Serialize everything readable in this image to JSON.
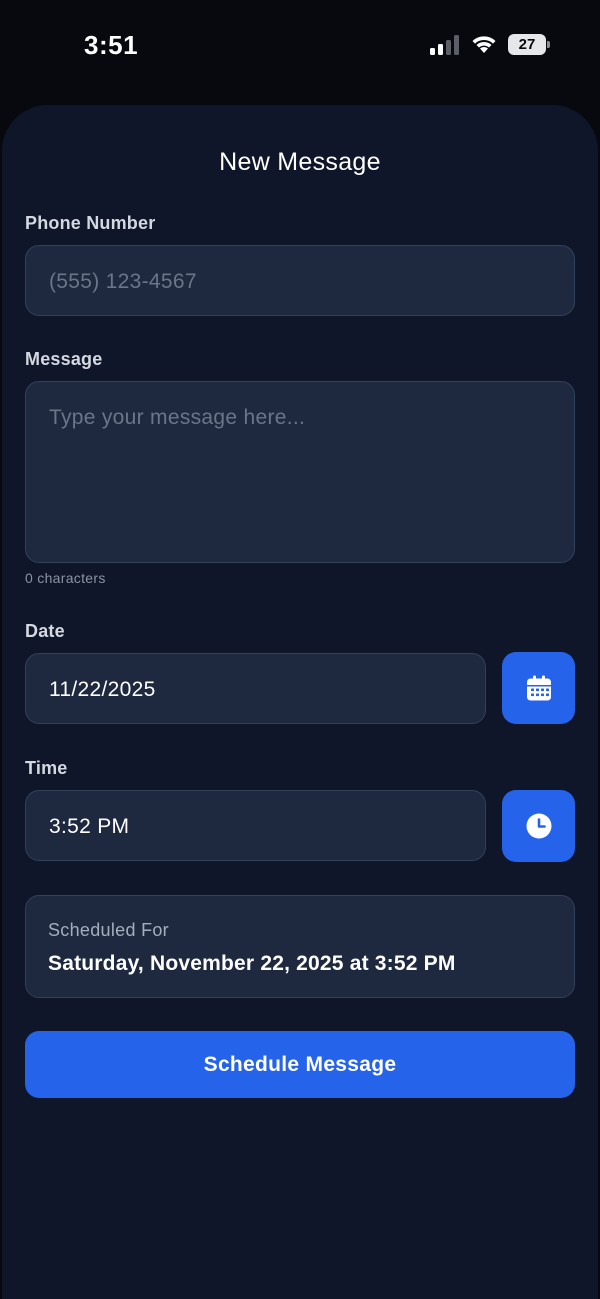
{
  "status_bar": {
    "time": "3:51",
    "battery_level": "27",
    "icons": [
      "signal-icon",
      "wifi-icon",
      "battery-icon"
    ]
  },
  "screen": {
    "title": "New Message"
  },
  "form": {
    "phone": {
      "label": "Phone Number",
      "value": "",
      "placeholder": "(555) 123-4567"
    },
    "message": {
      "label": "Message",
      "value": "",
      "placeholder": "Type your message here...",
      "char_count": "0 characters"
    },
    "date": {
      "label": "Date",
      "value": "11/22/2025",
      "button_icon": "calendar-icon"
    },
    "time": {
      "label": "Time",
      "value": "3:52 PM",
      "button_icon": "clock-icon"
    }
  },
  "summary": {
    "label": "Scheduled For",
    "value": "Saturday, November 22, 2025 at 3:52 PM"
  },
  "actions": {
    "submit_label": "Schedule Message"
  },
  "colors": {
    "background": "#0f1629",
    "field": "#1e2940",
    "accent": "#2563eb"
  }
}
